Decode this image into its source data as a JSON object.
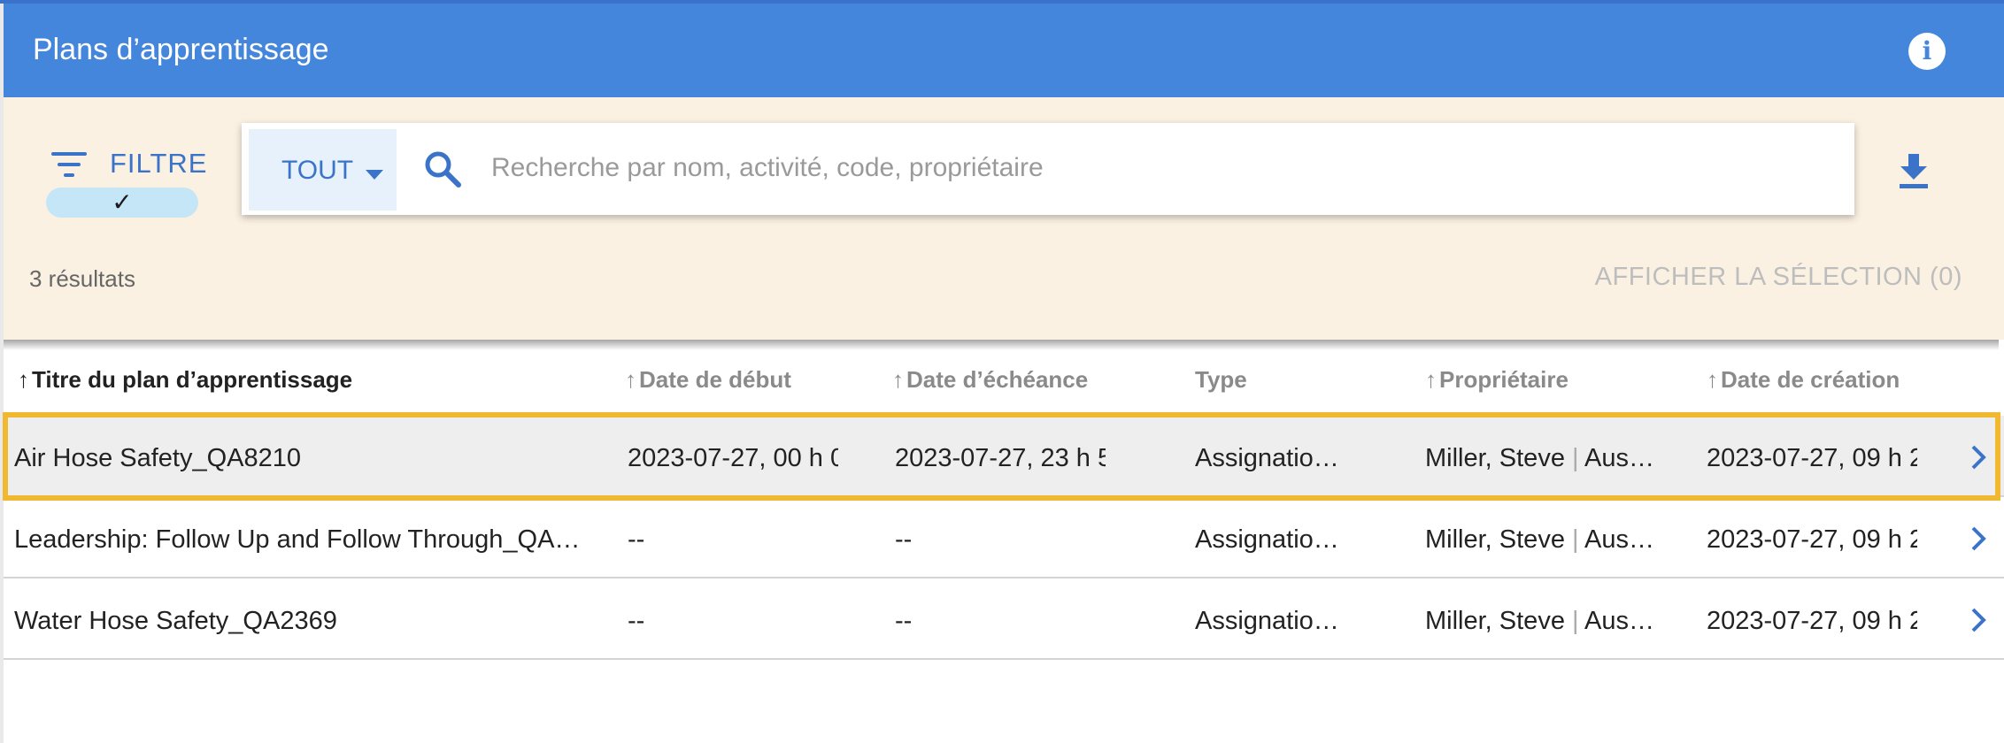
{
  "header": {
    "title": "Plans d’apprentissage",
    "info_icon": "info-icon"
  },
  "toolbar": {
    "filter_label": "FILTRE",
    "filter_check": "✓",
    "scope_label": "TOUT",
    "search_placeholder": "Recherche par nom, activité, code, propriétaire",
    "search_value": "",
    "result_count": "3 résultats",
    "show_selection": "AFFICHER LA SÉLECTION (0)"
  },
  "table": {
    "columns": [
      {
        "label": "Titre du plan d’apprentissage",
        "sort_arrow": "↑",
        "active": true
      },
      {
        "label": "Date de début",
        "sort_arrow": "↑"
      },
      {
        "label": "Date d’échéance",
        "sort_arrow": "↑"
      },
      {
        "label": "Type",
        "sort_arrow": ""
      },
      {
        "label": "Propriétaire",
        "sort_arrow": "↑"
      },
      {
        "label": "Date de création",
        "sort_arrow": "↑"
      }
    ],
    "rows": [
      {
        "title": "Air Hose Safety_QA8210",
        "start": "2023-07-27, 00 h 0",
        "due": "2023-07-27, 23 h 5",
        "type": "Assignatio…",
        "owner_name": "Miller, Steve",
        "owner_sep": "|",
        "owner_org": "Aus…",
        "created": "2023-07-27, 09 h 2"
      },
      {
        "title": "Leadership: Follow Up and Follow Through_QA…",
        "start": "--",
        "due": "--",
        "type": "Assignatio…",
        "owner_name": "Miller, Steve",
        "owner_sep": "|",
        "owner_org": "Aus…",
        "created": "2023-07-27, 09 h 2"
      },
      {
        "title": "Water Hose Safety_QA2369",
        "start": "--",
        "due": "--",
        "type": "Assignatio…",
        "owner_name": "Miller, Steve",
        "owner_sep": "|",
        "owner_org": "Aus…",
        "created": "2023-07-27, 09 h 2"
      }
    ],
    "selected_row": 0
  },
  "colors": {
    "header_bg": "#4486dc",
    "toolbar_bg": "#fbf1e3",
    "accent": "#3b73c9",
    "highlight": "#f1b931",
    "selected_row_bg": "#eeeeee"
  },
  "icons": [
    "info-icon",
    "filter-icon",
    "check-icon",
    "chevron-down-icon",
    "search-icon",
    "download-icon",
    "sort-up-arrow-icon",
    "chevron-right-icon"
  ]
}
